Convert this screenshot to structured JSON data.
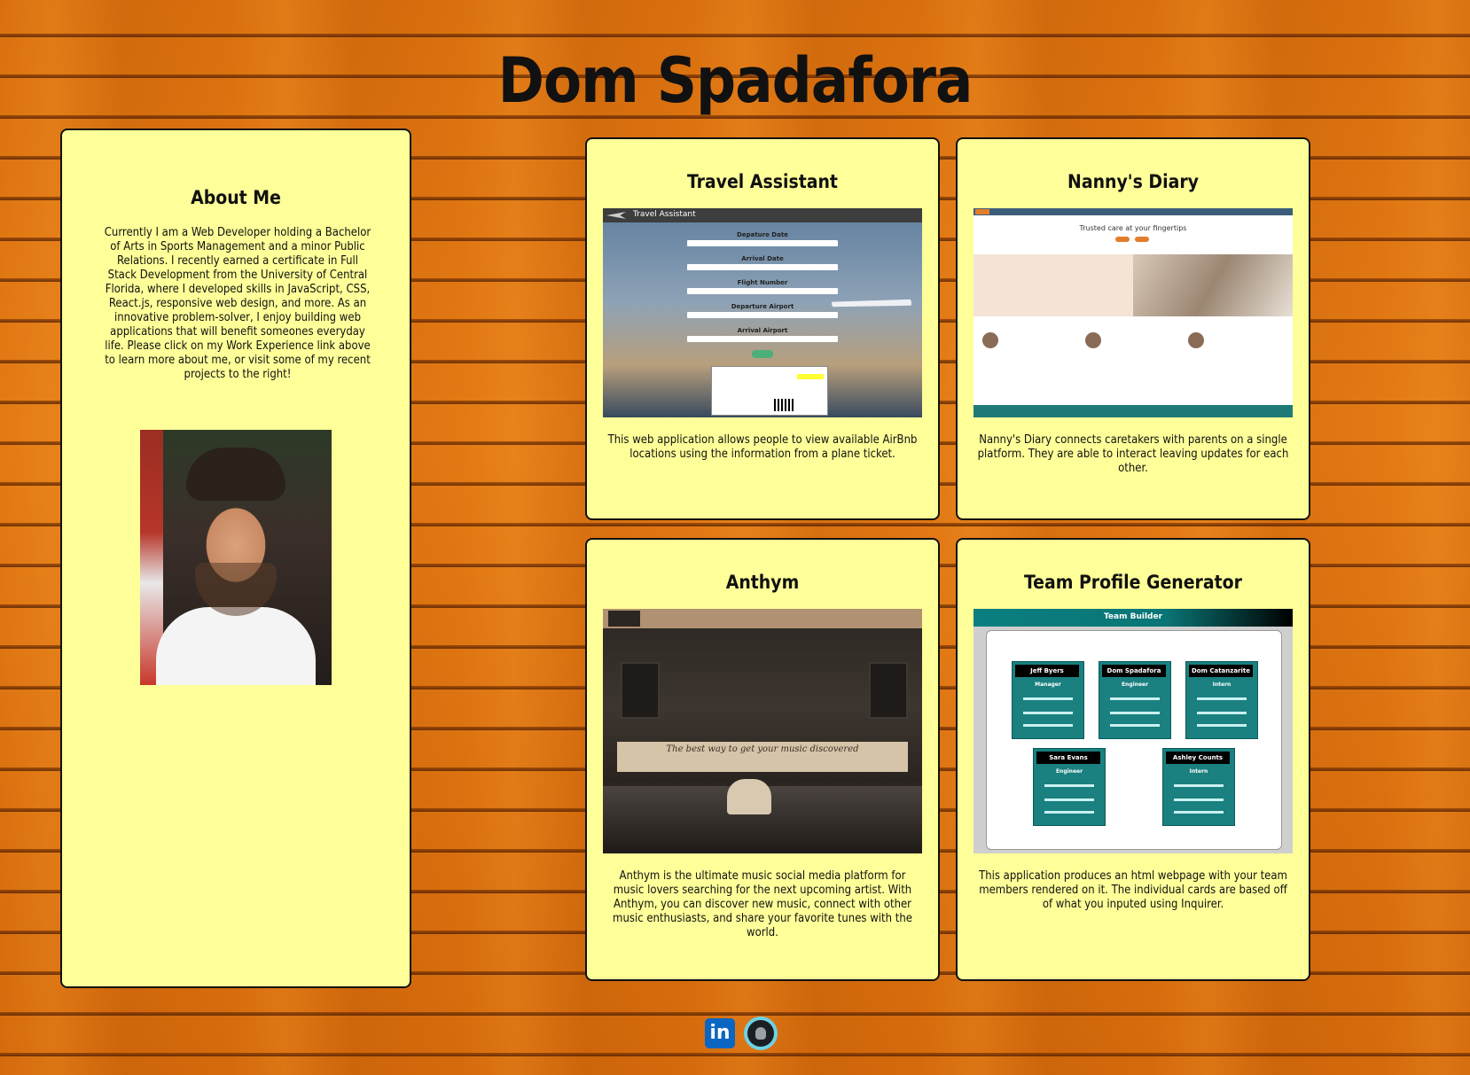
{
  "header": {
    "title": "Dom Spadafora"
  },
  "about": {
    "heading": "About Me",
    "bio": "Currently I am a Web Developer holding a Bachelor of Arts in Sports Management and a minor Public Relations. I recently earned a certificate in Full Stack Development from the University of Central Florida, where I developed skills in JavaScript, CSS, React.js, responsive web design, and more. As an innovative problem-solver, I enjoy building web applications that will benefit someones everyday life. Please click on my Work Experience link above to learn more about me, or visit some of my recent projects to the right!",
    "photo_icon": "profile-photo"
  },
  "projects": [
    {
      "title": "Travel Assistant",
      "description": "This web application allows people to view available AirBnb locations using the information from a plane ticket.",
      "screenshot": {
        "app_title": "Travel Assistant",
        "labels": [
          "Depature Date",
          "Arrival Date",
          "Flight Number",
          "Departure Airport",
          "Arrival Airport"
        ]
      }
    },
    {
      "title": "Nanny's Diary",
      "description": "Nanny's Diary connects caretakers with parents on a single platform. They are able to interact leaving updates for each other.",
      "screenshot": {
        "headline": "Trusted care at your fingertips"
      }
    },
    {
      "title": "Anthym",
      "description": "Anthym is the ultimate music social media platform for music lovers searching for the next upcoming artist. With Anthym, you can discover new music, connect with other music enthusiasts, and share your favorite tunes with the world.",
      "screenshot": {
        "banner": "The best way to get your music discovered"
      }
    },
    {
      "title": "Team Profile Generator",
      "description": "This application produces an html webpage with your team members rendered on it. The individual cards are based off of what you inputed using Inquirer.",
      "screenshot": {
        "header": "Team Builder",
        "members": [
          {
            "name": "Jeff Byers",
            "role": "Manager"
          },
          {
            "name": "Dom Spadafora",
            "role": "Engineer"
          },
          {
            "name": "Dom Catanzarite",
            "role": "Intern"
          },
          {
            "name": "Sara Evans",
            "role": "Engineer"
          },
          {
            "name": "Ashley Counts",
            "role": "Intern"
          }
        ]
      }
    }
  ],
  "footer": {
    "linkedin_label": "in",
    "icons": [
      "linkedin-icon",
      "github-icon"
    ]
  },
  "colors": {
    "card_bg": "#ffff99",
    "border": "#111111",
    "linkedin": "#0a66c2",
    "wood": "#d9700f"
  }
}
